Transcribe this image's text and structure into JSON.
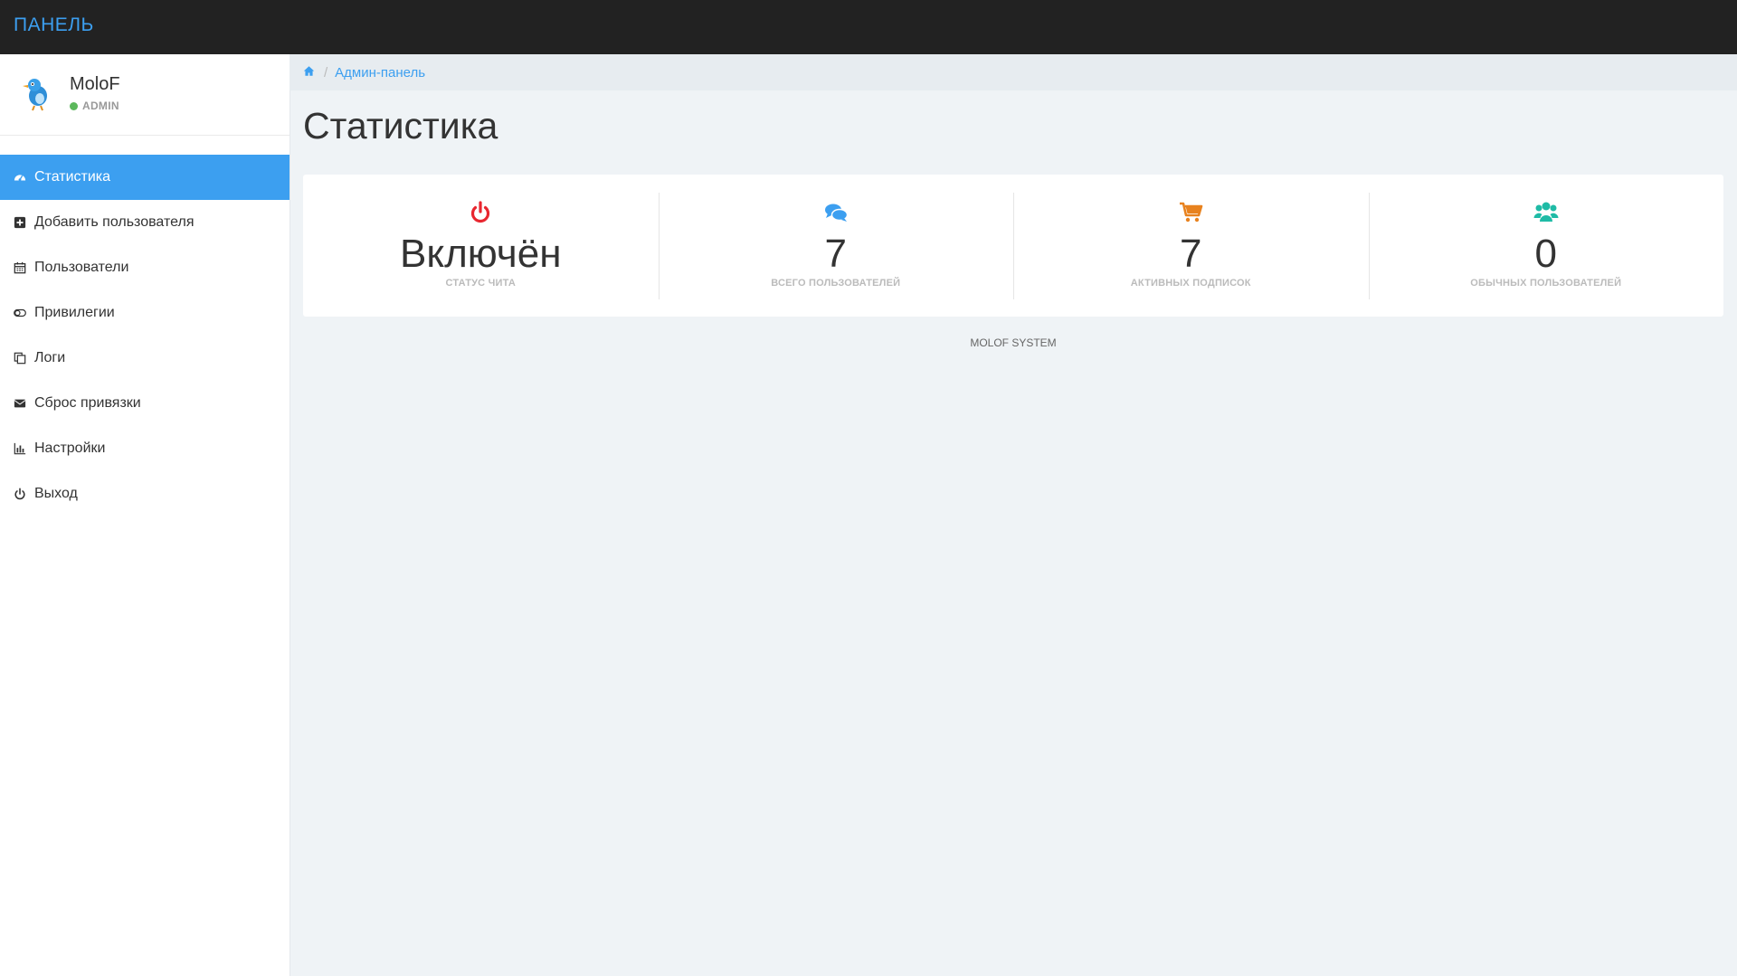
{
  "header": {
    "brand": "ПАНЕЛЬ"
  },
  "user": {
    "name": "MoloF",
    "role": "ADMIN",
    "status_color": "#5cb85c"
  },
  "sidebar": {
    "items": [
      {
        "label": "Статистика",
        "icon": "dashboard-icon",
        "active": true
      },
      {
        "label": "Добавить пользователя",
        "icon": "plus-square-icon"
      },
      {
        "label": "Пользователи",
        "icon": "calendar-icon"
      },
      {
        "label": "Привилегии",
        "icon": "toggle-icon"
      },
      {
        "label": "Логи",
        "icon": "copy-icon"
      },
      {
        "label": "Сброс привязки",
        "icon": "envelope-icon"
      },
      {
        "label": "Настройки",
        "icon": "bar-chart-icon"
      },
      {
        "label": "Выход",
        "icon": "power-icon"
      }
    ]
  },
  "breadcrumb": {
    "home_icon": "home-icon",
    "current": "Админ-панель"
  },
  "page": {
    "title": "Статистика"
  },
  "stats": [
    {
      "value": "Включён",
      "label": "СТАТУС ЧИТА",
      "icon": "power-icon",
      "color": "#e8262f"
    },
    {
      "value": "7",
      "label": "ВСЕГО ПОЛЬЗОВАТЕЛЕЙ",
      "icon": "comments-icon",
      "color": "#3c9ff0"
    },
    {
      "value": "7",
      "label": "АКТИВНЫХ ПОДПИСОК",
      "icon": "cart-icon",
      "color": "#e8821e"
    },
    {
      "value": "0",
      "label": "ОБЫЧНЫХ ПОЛЬЗОВАТЕЛЕЙ",
      "icon": "users-icon",
      "color": "#1fbba6"
    }
  ],
  "footer": {
    "text": "MOLOF SYSTEM"
  },
  "colors": {
    "accent": "#3c9ff0",
    "topbar": "#222222"
  }
}
